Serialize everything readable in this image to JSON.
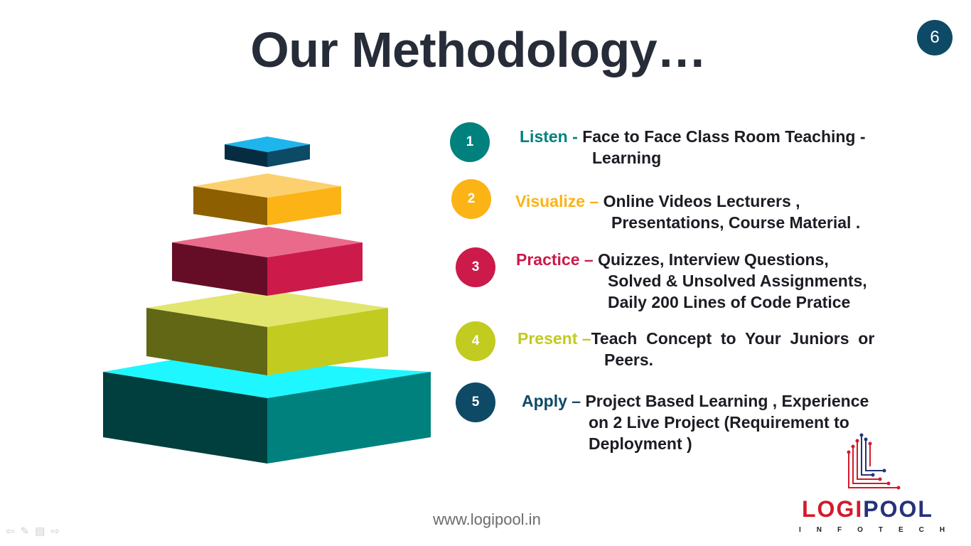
{
  "slide": {
    "title": "Our Methodology…",
    "page_number": "6"
  },
  "steps": [
    {
      "num": "1",
      "title": "Listen",
      "sep": " - ",
      "line1": "Face to Face Class Room Teaching -",
      "line2": "Learning",
      "color": "#00817e"
    },
    {
      "num": "2",
      "title": "Visualize",
      "sep": " – ",
      "line1": "Online Videos Lecturers ,",
      "line2": "Presentations, Course Material  .",
      "color": "#fbb316"
    },
    {
      "num": "3",
      "title": "Practice",
      "sep": " – ",
      "line1": "Quizzes, Interview Questions,",
      "line2": "Solved & Unsolved  Assignments,",
      "line3": "Daily 200 Lines of Code Pratice",
      "color": "#cc1a4b"
    },
    {
      "num": "4",
      "title": "Present",
      "sep": " –",
      "line1": "Teach  Concept  to  Your  Juniors  or",
      "line2": "Peers.",
      "color": "#c2cb20"
    },
    {
      "num": "5",
      "title": "Apply",
      "sep": " – ",
      "line1": "Project Based Learning , Experience",
      "line2": "on 2 Live Project (Requirement to",
      "line3": "Deployment )",
      "color": "#0e4a66"
    }
  ],
  "pyramid_colors": {
    "level1": {
      "top": "#1eb5ec",
      "left": "#062c42",
      "right": "#0c4a66"
    },
    "level2": {
      "top": "#fcd06e",
      "left": "#8d5f00",
      "right": "#fbb316"
    },
    "level3": {
      "top": "#ea6a8c",
      "left": "#650d26",
      "right": "#cc1a4b"
    },
    "level4": {
      "top": "#e2e66e",
      "left": "#616714",
      "right": "#c2cb20"
    },
    "level5": {
      "top": "#1ef7ff",
      "left": "#003f3d",
      "right": "#00817e"
    }
  },
  "footer": {
    "url": "www.logipool.in"
  },
  "logo": {
    "part1": "LOGI",
    "part2": "POOL",
    "sub": "INFOTECH"
  },
  "nav_icons": [
    "back-arrow-icon",
    "pen-icon",
    "menu-icon",
    "forward-arrow-icon"
  ]
}
